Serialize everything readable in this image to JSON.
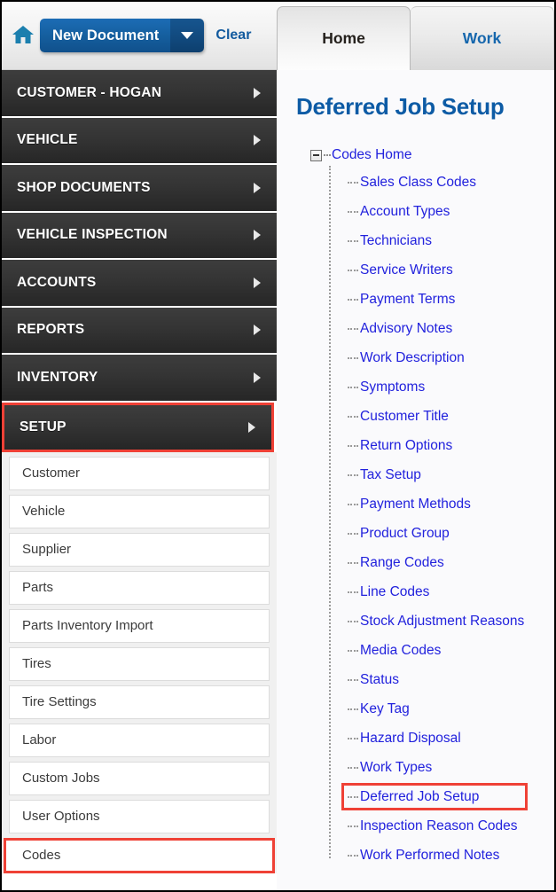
{
  "toolbar": {
    "home_icon": "home-icon",
    "new_document_label": "New Document",
    "dropdown_icon": "chevron-down-icon",
    "clear_label": "Clear"
  },
  "tabs": [
    {
      "label": "Home",
      "active": true
    },
    {
      "label": "Work",
      "active": false
    }
  ],
  "sidebar": {
    "nav_items": [
      {
        "label": "CUSTOMER - HOGAN",
        "highlighted": false
      },
      {
        "label": "VEHICLE",
        "highlighted": false
      },
      {
        "label": "SHOP DOCUMENTS",
        "highlighted": false
      },
      {
        "label": "VEHICLE INSPECTION",
        "highlighted": false
      },
      {
        "label": "ACCOUNTS",
        "highlighted": false
      },
      {
        "label": "REPORTS",
        "highlighted": false
      },
      {
        "label": "INVENTORY",
        "highlighted": false
      },
      {
        "label": "SETUP",
        "highlighted": true
      }
    ],
    "sub_items": [
      {
        "label": "Customer",
        "highlighted": false
      },
      {
        "label": "Vehicle",
        "highlighted": false
      },
      {
        "label": "Supplier",
        "highlighted": false
      },
      {
        "label": "Parts",
        "highlighted": false
      },
      {
        "label": "Parts Inventory Import",
        "highlighted": false
      },
      {
        "label": "Tires",
        "highlighted": false
      },
      {
        "label": "Tire Settings",
        "highlighted": false
      },
      {
        "label": "Labor",
        "highlighted": false
      },
      {
        "label": "Custom Jobs",
        "highlighted": false
      },
      {
        "label": "User Options",
        "highlighted": false
      },
      {
        "label": "Codes",
        "highlighted": true
      }
    ]
  },
  "main": {
    "title": "Deferred Job Setup",
    "tree": {
      "root_label": "Codes Home",
      "root_toggle_icon": "minus-box-icon",
      "children": [
        {
          "label": "Sales Class Codes",
          "highlighted": false
        },
        {
          "label": "Account Types",
          "highlighted": false
        },
        {
          "label": "Technicians",
          "highlighted": false
        },
        {
          "label": "Service Writers",
          "highlighted": false
        },
        {
          "label": "Payment Terms",
          "highlighted": false
        },
        {
          "label": "Advisory Notes",
          "highlighted": false
        },
        {
          "label": "Work Description",
          "highlighted": false
        },
        {
          "label": "Symptoms",
          "highlighted": false
        },
        {
          "label": "Customer Title",
          "highlighted": false
        },
        {
          "label": "Return Options",
          "highlighted": false
        },
        {
          "label": "Tax Setup",
          "highlighted": false
        },
        {
          "label": "Payment Methods",
          "highlighted": false
        },
        {
          "label": "Product Group",
          "highlighted": false
        },
        {
          "label": "Range Codes",
          "highlighted": false
        },
        {
          "label": "Line Codes",
          "highlighted": false
        },
        {
          "label": "Stock Adjustment Reasons",
          "highlighted": false
        },
        {
          "label": "Media Codes",
          "highlighted": false
        },
        {
          "label": "Status",
          "highlighted": false
        },
        {
          "label": "Key Tag",
          "highlighted": false
        },
        {
          "label": "Hazard Disposal",
          "highlighted": false
        },
        {
          "label": "Work Types",
          "highlighted": false
        },
        {
          "label": "Deferred Job Setup",
          "highlighted": true
        },
        {
          "label": "Inspection Reason Codes",
          "highlighted": false
        },
        {
          "label": "Work Performed Notes",
          "highlighted": false
        }
      ]
    }
  },
  "colors": {
    "accent_blue": "#155f9f",
    "link_blue": "#2222dd",
    "title_blue": "#0d5ba5",
    "highlight_red": "#ef4136",
    "nav_dark": "#343434"
  }
}
